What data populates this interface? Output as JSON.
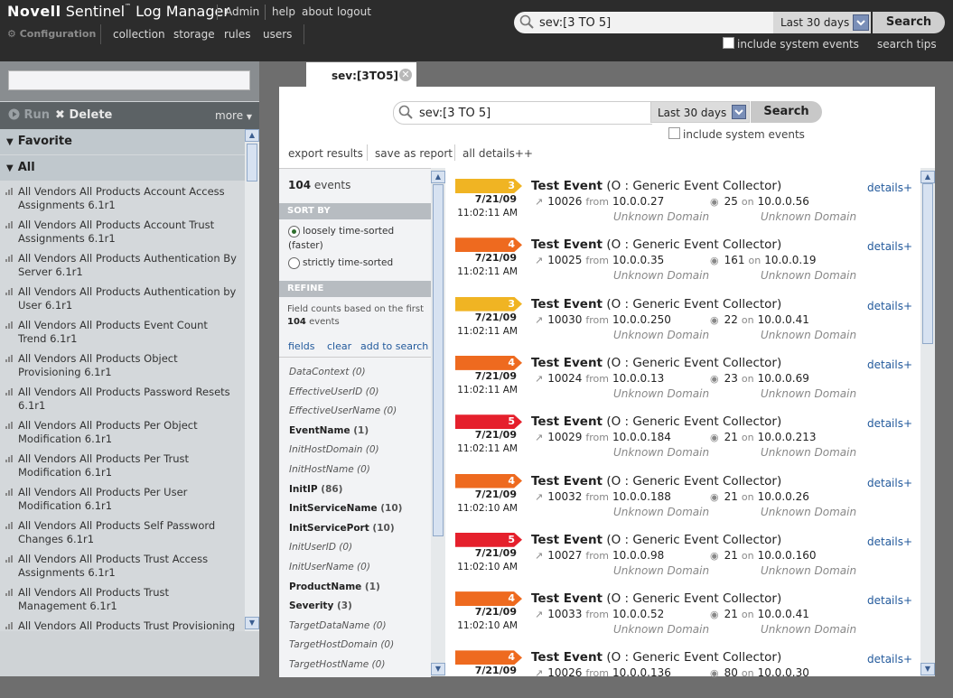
{
  "app": {
    "brand_a": "Novell",
    "brand_b": "Sentinel",
    "brand_tm": "™",
    "brand_c": "Log Manager",
    "nav": [
      "Admin",
      "help",
      "about",
      "logout"
    ],
    "config_label": "Configuration",
    "subnav": [
      "collection",
      "storage",
      "rules",
      "users"
    ]
  },
  "global_search": {
    "query": "sev:[3 TO 5]",
    "period": "Last 30 days",
    "search_label": "Search",
    "include_system": "include system events",
    "tips": "search tips"
  },
  "left": {
    "toolbar": {
      "run": "Run",
      "delete": "Delete",
      "more": "more"
    },
    "groups": [
      {
        "label": "Favorite"
      },
      {
        "label": "All"
      }
    ],
    "items": [
      "All Vendors All Products Account Access Assignments 6.1r1",
      "All Vendors All Products Account Trust Assignments 6.1r1",
      "All Vendors All Products Authentication By Server 6.1r1",
      "All Vendors All Products Authentication by User 6.1r1",
      "All Vendors All Products Event Count Trend 6.1r1",
      "All Vendors All Products Object Provisioning 6.1r1",
      "All Vendors All Products Password Resets 6.1r1",
      "All Vendors All Products Per Object Modification 6.1r1",
      "All Vendors All Products Per Trust Modification 6.1r1",
      "All Vendors All Products Per User Modification 6.1r1",
      "All Vendors All Products Self Password Changes 6.1r1",
      "All Vendors All Products Trust Access Assignments 6.1r1",
      "All Vendors All Products Trust Management 6.1r1",
      "All Vendors All Products Trust Provisioning"
    ]
  },
  "tab": {
    "label": "sev:[3TO5]"
  },
  "main": {
    "query": "sev:[3 TO 5]",
    "period": "Last 30 days",
    "search_label": "Search",
    "include_system": "include system events",
    "actions": [
      "export results",
      "save as report",
      "all details++"
    ]
  },
  "filters": {
    "count": "104",
    "count_label": "events",
    "sort_header": "SORT BY",
    "sort_opt1a": "loosely time-sorted",
    "sort_opt1b": "(faster)",
    "sort_opt2": "strictly time-sorted",
    "refine_header": "REFINE",
    "refine_text": "Field counts based on the first",
    "refine_count": "104",
    "refine_suffix": "events",
    "links": [
      "fields",
      "clear",
      "add to search"
    ],
    "fields": [
      {
        "name": "DataContext",
        "count": "(0)",
        "bold": false
      },
      {
        "name": "EffectiveUserID",
        "count": "(0)",
        "bold": false
      },
      {
        "name": "EffectiveUserName",
        "count": "(0)",
        "bold": false
      },
      {
        "name": "EventName",
        "count": "(1)",
        "bold": true
      },
      {
        "name": "InitHostDomain",
        "count": "(0)",
        "bold": false
      },
      {
        "name": "InitHostName",
        "count": "(0)",
        "bold": false
      },
      {
        "name": "InitIP",
        "count": "(86)",
        "bold": true
      },
      {
        "name": "InitServiceName",
        "count": "(10)",
        "bold": true
      },
      {
        "name": "InitServicePort",
        "count": "(10)",
        "bold": true
      },
      {
        "name": "InitUserID",
        "count": "(0)",
        "bold": false
      },
      {
        "name": "InitUserName",
        "count": "(0)",
        "bold": false
      },
      {
        "name": "ProductName",
        "count": "(1)",
        "bold": true
      },
      {
        "name": "Severity",
        "count": "(3)",
        "bold": true
      },
      {
        "name": "TargetDataName",
        "count": "(0)",
        "bold": false
      },
      {
        "name": "TargetHostDomain",
        "count": "(0)",
        "bold": false
      },
      {
        "name": "TargetHostName",
        "count": "(0)",
        "bold": false
      }
    ]
  },
  "events": [
    {
      "sev": "3",
      "color": "#f0b423",
      "date": "7/21/09",
      "time": "11:02:11 AM",
      "title": "Test Event",
      "collector": "(O :  Generic Event Collector)",
      "sport": "10026",
      "sip": "10.0.0.27",
      "dport": "25",
      "dip": "10.0.0.56",
      "sdom": "Unknown Domain",
      "ddom": "Unknown Domain",
      "details": "details+"
    },
    {
      "sev": "4",
      "color": "#ee6a1f",
      "date": "7/21/09",
      "time": "11:02:11 AM",
      "title": "Test Event",
      "collector": "(O :  Generic Event Collector)",
      "sport": "10025",
      "sip": "10.0.0.35",
      "dport": "161",
      "dip": "10.0.0.19",
      "sdom": "Unknown Domain",
      "ddom": "Unknown Domain",
      "details": "details+"
    },
    {
      "sev": "3",
      "color": "#f0b423",
      "date": "7/21/09",
      "time": "11:02:11 AM",
      "title": "Test Event",
      "collector": "(O :  Generic Event Collector)",
      "sport": "10030",
      "sip": "10.0.0.250",
      "dport": "22",
      "dip": "10.0.0.41",
      "sdom": "Unknown Domain",
      "ddom": "Unknown Domain",
      "details": "details+"
    },
    {
      "sev": "4",
      "color": "#ee6a1f",
      "date": "7/21/09",
      "time": "11:02:11 AM",
      "title": "Test Event",
      "collector": "(O :  Generic Event Collector)",
      "sport": "10024",
      "sip": "10.0.0.13",
      "dport": "23",
      "dip": "10.0.0.69",
      "sdom": "Unknown Domain",
      "ddom": "Unknown Domain",
      "details": "details+"
    },
    {
      "sev": "5",
      "color": "#e5202c",
      "date": "7/21/09",
      "time": "11:02:11 AM",
      "title": "Test Event",
      "collector": "(O :  Generic Event Collector)",
      "sport": "10029",
      "sip": "10.0.0.184",
      "dport": "21",
      "dip": "10.0.0.213",
      "sdom": "Unknown Domain",
      "ddom": "Unknown Domain",
      "details": "details+"
    },
    {
      "sev": "4",
      "color": "#ee6a1f",
      "date": "7/21/09",
      "time": "11:02:10 AM",
      "title": "Test Event",
      "collector": "(O :  Generic Event Collector)",
      "sport": "10032",
      "sip": "10.0.0.188",
      "dport": "21",
      "dip": "10.0.0.26",
      "sdom": "Unknown Domain",
      "ddom": "Unknown Domain",
      "details": "details+"
    },
    {
      "sev": "5",
      "color": "#e5202c",
      "date": "7/21/09",
      "time": "11:02:10 AM",
      "title": "Test Event",
      "collector": "(O :  Generic Event Collector)",
      "sport": "10027",
      "sip": "10.0.0.98",
      "dport": "21",
      "dip": "10.0.0.160",
      "sdom": "Unknown Domain",
      "ddom": "Unknown Domain",
      "details": "details+"
    },
    {
      "sev": "4",
      "color": "#ee6a1f",
      "date": "7/21/09",
      "time": "11:02:10 AM",
      "title": "Test Event",
      "collector": "(O :  Generic Event Collector)",
      "sport": "10033",
      "sip": "10.0.0.52",
      "dport": "21",
      "dip": "10.0.0.41",
      "sdom": "Unknown Domain",
      "ddom": "Unknown Domain",
      "details": "details+"
    },
    {
      "sev": "4",
      "color": "#ee6a1f",
      "date": "7/21/09",
      "time": "",
      "title": "Test Event",
      "collector": "(O :  Generic Event Collector)",
      "sport": "10026",
      "sip": "10.0.0.136",
      "dport": "80",
      "dip": "10.0.0.30",
      "sdom": "",
      "ddom": "",
      "details": "details+"
    }
  ]
}
